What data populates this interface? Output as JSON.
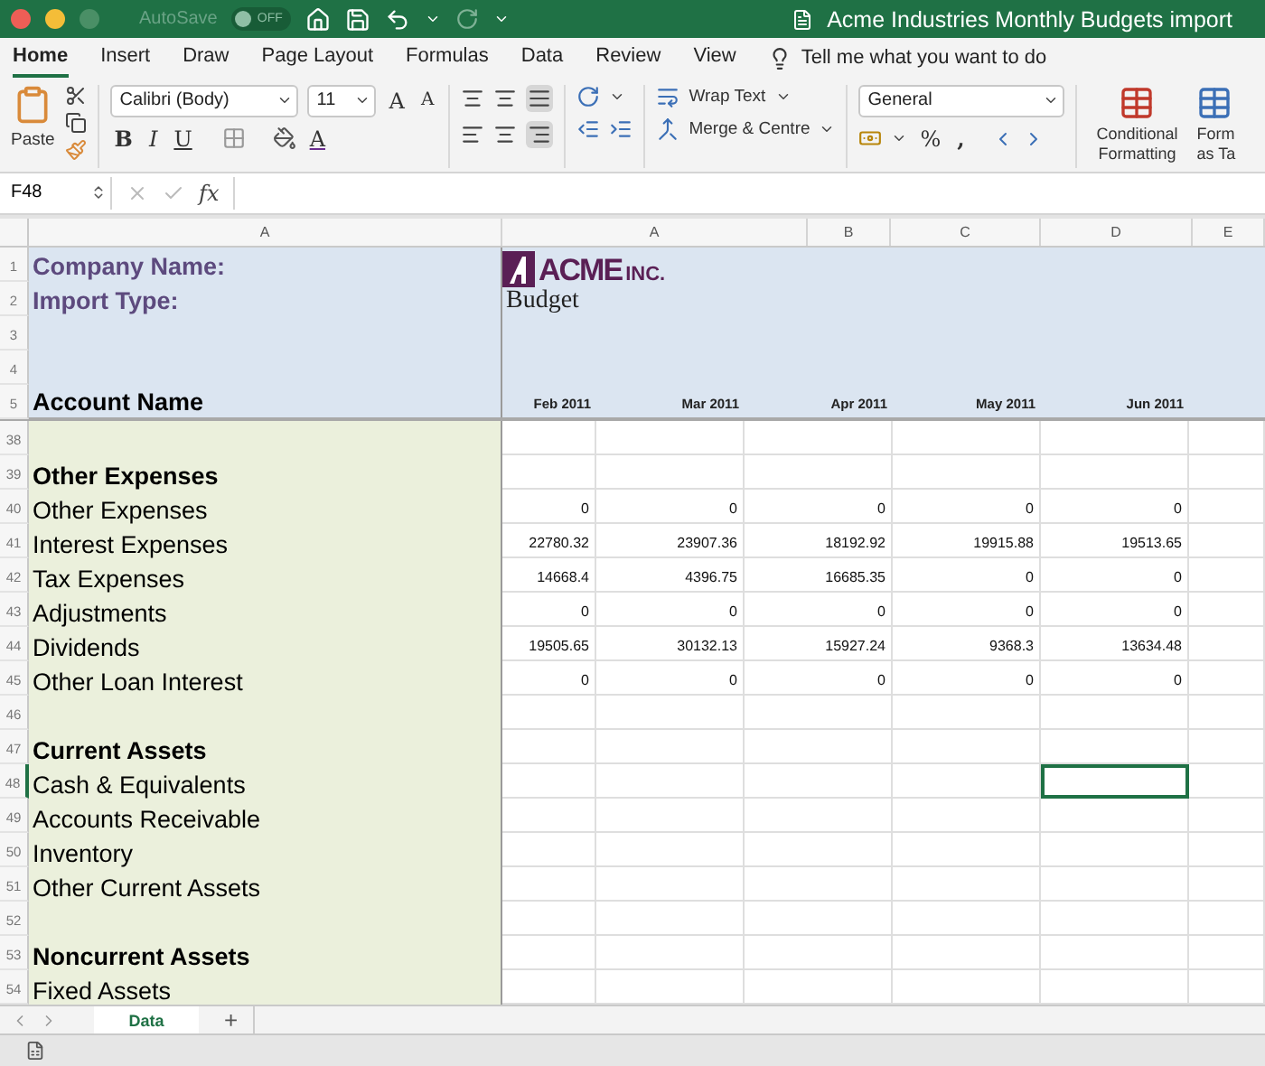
{
  "title_bar": {
    "autosave_label": "AutoSave",
    "autosave_on": false,
    "autosave_state": "OFF",
    "title": "Acme Industries Monthly Budgets import"
  },
  "ribbon_tabs": [
    {
      "label": "Home",
      "selected": true
    },
    {
      "label": "Insert",
      "selected": false
    },
    {
      "label": "Draw",
      "selected": false
    },
    {
      "label": "Page Layout",
      "selected": false
    },
    {
      "label": "Formulas",
      "selected": false
    },
    {
      "label": "Data",
      "selected": false
    },
    {
      "label": "Review",
      "selected": false
    },
    {
      "label": "View",
      "selected": false
    }
  ],
  "tell_me": "Tell me what you want to do",
  "ribbon": {
    "paste": "Paste",
    "font_name": "Calibri (Body)",
    "font_size": "11",
    "grow_font": "A",
    "shrink_font": "A",
    "bold": "B",
    "italic": "I",
    "underline": "U",
    "font_color": "A",
    "wrap_text": "Wrap Text",
    "merge": "Merge & Centre",
    "number_format": "General",
    "percent": "%",
    "comma": ",",
    "conditional": "Conditional Formatting",
    "format_table": "Form as Ta"
  },
  "formula_bar": {
    "name_box": "F48",
    "fx": "fx"
  },
  "column_headers": [
    "A",
    "A",
    "B",
    "C",
    "D",
    "E"
  ],
  "header_rows": {
    "row_numbers": [
      "1",
      "2",
      "3",
      "4",
      "5"
    ],
    "company_name_label": "Company Name:",
    "import_type_label": "Import Type:",
    "account_name_label": "Account Name",
    "logo_name": "ACME",
    "logo_suffix": "INC.",
    "import_type": "Budget",
    "months": [
      "Feb 2011",
      "Mar 2011",
      "Apr 2011",
      "May 2011",
      "Jun 2011"
    ]
  },
  "rows": [
    {
      "num": "38",
      "kind": "blank",
      "cells": [
        {
          "selected": false
        },
        {
          "selected": false
        },
        {
          "selected": false
        },
        {
          "selected": false
        },
        {
          "selected": false
        },
        {
          "selected": false
        }
      ]
    },
    {
      "num": "39",
      "kind": "section",
      "label": "Other Expenses",
      "cells": [
        {
          "selected": false
        },
        {
          "selected": false
        },
        {
          "selected": false
        },
        {
          "selected": false
        },
        {
          "selected": false
        },
        {
          "selected": false
        }
      ]
    },
    {
      "num": "40",
      "kind": "item",
      "label": "Other Expenses",
      "cells": [
        {
          "value": "0",
          "selected": false
        },
        {
          "value": "0",
          "selected": false
        },
        {
          "value": "0",
          "selected": false
        },
        {
          "value": "0",
          "selected": false
        },
        {
          "value": "0",
          "selected": false
        },
        {
          "selected": false
        }
      ]
    },
    {
      "num": "41",
      "kind": "item",
      "label": "Interest Expenses",
      "cells": [
        {
          "value": "22780.32",
          "selected": false
        },
        {
          "value": "23907.36",
          "selected": false
        },
        {
          "value": "18192.92",
          "selected": false
        },
        {
          "value": "19915.88",
          "selected": false
        },
        {
          "value": "19513.65",
          "selected": false
        },
        {
          "selected": false
        }
      ]
    },
    {
      "num": "42",
      "kind": "item",
      "label": "Tax Expenses",
      "cells": [
        {
          "value": "14668.4",
          "selected": false
        },
        {
          "value": "4396.75",
          "selected": false
        },
        {
          "value": "16685.35",
          "selected": false
        },
        {
          "value": "0",
          "selected": false
        },
        {
          "value": "0",
          "selected": false
        },
        {
          "selected": false
        }
      ]
    },
    {
      "num": "43",
      "kind": "item",
      "label": "Adjustments",
      "cells": [
        {
          "value": "0",
          "selected": false
        },
        {
          "value": "0",
          "selected": false
        },
        {
          "value": "0",
          "selected": false
        },
        {
          "value": "0",
          "selected": false
        },
        {
          "value": "0",
          "selected": false
        },
        {
          "selected": false
        }
      ]
    },
    {
      "num": "44",
      "kind": "item",
      "label": "Dividends",
      "cells": [
        {
          "value": "19505.65",
          "selected": false
        },
        {
          "value": "30132.13",
          "selected": false
        },
        {
          "value": "15927.24",
          "selected": false
        },
        {
          "value": "9368.3",
          "selected": false
        },
        {
          "value": "13634.48",
          "selected": false
        },
        {
          "selected": false
        }
      ]
    },
    {
      "num": "45",
      "kind": "item",
      "label": "Other Loan Interest",
      "cells": [
        {
          "value": "0",
          "selected": false
        },
        {
          "value": "0",
          "selected": false
        },
        {
          "value": "0",
          "selected": false
        },
        {
          "value": "0",
          "selected": false
        },
        {
          "value": "0",
          "selected": false
        },
        {
          "selected": false
        }
      ]
    },
    {
      "num": "46",
      "kind": "blank",
      "cells": [
        {
          "selected": false
        },
        {
          "selected": false
        },
        {
          "selected": false
        },
        {
          "selected": false
        },
        {
          "selected": false
        },
        {
          "selected": false
        }
      ]
    },
    {
      "num": "47",
      "kind": "section",
      "label": "Current Assets",
      "cells": [
        {
          "selected": false
        },
        {
          "selected": false
        },
        {
          "selected": false
        },
        {
          "selected": false
        },
        {
          "selected": false
        },
        {
          "selected": false
        }
      ]
    },
    {
      "num": "48",
      "kind": "item",
      "label": "Cash & Equivalents",
      "cells": [
        {
          "selected": false
        },
        {
          "selected": false
        },
        {
          "selected": false
        },
        {
          "selected": false
        },
        {
          "selected": true
        },
        {
          "selected": false
        }
      ]
    },
    {
      "num": "49",
      "kind": "item",
      "label": "Accounts Receivable",
      "cells": [
        {
          "selected": false
        },
        {
          "selected": false
        },
        {
          "selected": false
        },
        {
          "selected": false
        },
        {
          "selected": false
        },
        {
          "selected": false
        }
      ]
    },
    {
      "num": "50",
      "kind": "item",
      "label": "Inventory",
      "cells": [
        {
          "selected": false
        },
        {
          "selected": false
        },
        {
          "selected": false
        },
        {
          "selected": false
        },
        {
          "selected": false
        },
        {
          "selected": false
        }
      ]
    },
    {
      "num": "51",
      "kind": "item",
      "label": "Other Current Assets",
      "cells": [
        {
          "selected": false
        },
        {
          "selected": false
        },
        {
          "selected": false
        },
        {
          "selected": false
        },
        {
          "selected": false
        },
        {
          "selected": false
        }
      ]
    },
    {
      "num": "52",
      "kind": "blank",
      "cells": [
        {
          "selected": false
        },
        {
          "selected": false
        },
        {
          "selected": false
        },
        {
          "selected": false
        },
        {
          "selected": false
        },
        {
          "selected": false
        }
      ]
    },
    {
      "num": "53",
      "kind": "section",
      "label": "Noncurrent Assets",
      "cells": [
        {
          "selected": false
        },
        {
          "selected": false
        },
        {
          "selected": false
        },
        {
          "selected": false
        },
        {
          "selected": false
        },
        {
          "selected": false
        }
      ]
    },
    {
      "num": "54",
      "kind": "item",
      "label": "Fixed Assets",
      "cells": [
        {
          "selected": false
        },
        {
          "selected": false
        },
        {
          "selected": false
        },
        {
          "selected": false
        },
        {
          "selected": false
        },
        {
          "selected": false
        }
      ]
    }
  ],
  "sheet_tabs": [
    {
      "label": "Data",
      "selected": true
    }
  ],
  "add_sheet": "+"
}
